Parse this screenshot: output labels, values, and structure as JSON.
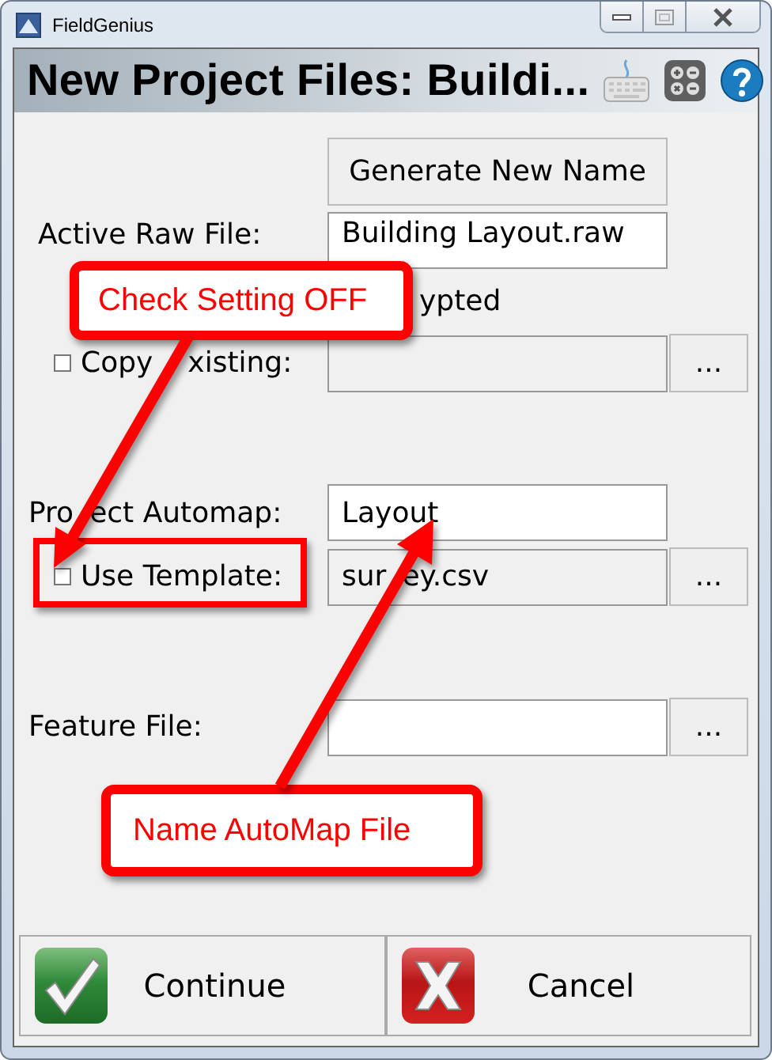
{
  "window": {
    "title": "FieldGenius"
  },
  "header": {
    "title": "New Project Files: Buildi..."
  },
  "generate_button": "Generate New Name",
  "raw_file": {
    "label": "Active Raw File:",
    "value": "Building Layout.raw"
  },
  "encrypted": {
    "label": "ypted"
  },
  "copy_existing": {
    "label_parts": [
      "Copy",
      "xisting:"
    ],
    "checked": false,
    "disabled": true,
    "browse": "..."
  },
  "project_automap": {
    "label_parts": [
      "Pro",
      "ect Automap:"
    ],
    "value": "Layout"
  },
  "use_template": {
    "label": "Use Template:",
    "checked": false,
    "value_parts": [
      "sur",
      "ey.csv"
    ],
    "disabled": true,
    "browse": "..."
  },
  "feature_file": {
    "label": "Feature File:",
    "disabled": false,
    "browse": "..."
  },
  "buttons": [
    {
      "kind": "ok",
      "label": "Continue"
    },
    {
      "kind": "cancel",
      "label": "Cancel"
    }
  ],
  "callouts": [
    {
      "text": "Check Setting OFF"
    },
    {
      "text": "Name AutoMap File"
    }
  ]
}
